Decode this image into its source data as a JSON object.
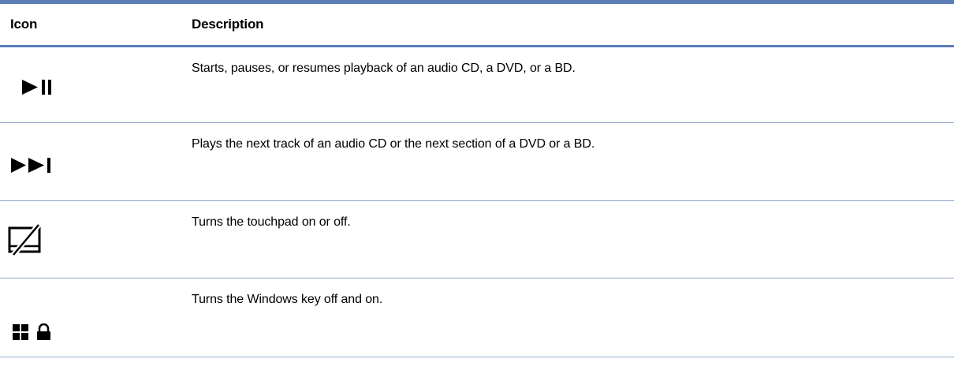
{
  "table": {
    "headers": {
      "icon": "Icon",
      "description": "Description"
    },
    "rows": [
      {
        "icon": "play-pause-icon",
        "description": "Starts, pauses, or resumes playback of an audio CD, a DVD, or a BD."
      },
      {
        "icon": "next-track-icon",
        "description": "Plays the next track of an audio CD or the next section of a DVD or a BD."
      },
      {
        "icon": "touchpad-off-icon",
        "description": "Turns the touchpad on or off."
      },
      {
        "icon": "windows-key-lock-icon",
        "description": "Turns the Windows key off and on."
      }
    ]
  },
  "colors": {
    "rule": "#5b7eb8",
    "row_rule": "#8fa8cc",
    "text": "#000000"
  }
}
